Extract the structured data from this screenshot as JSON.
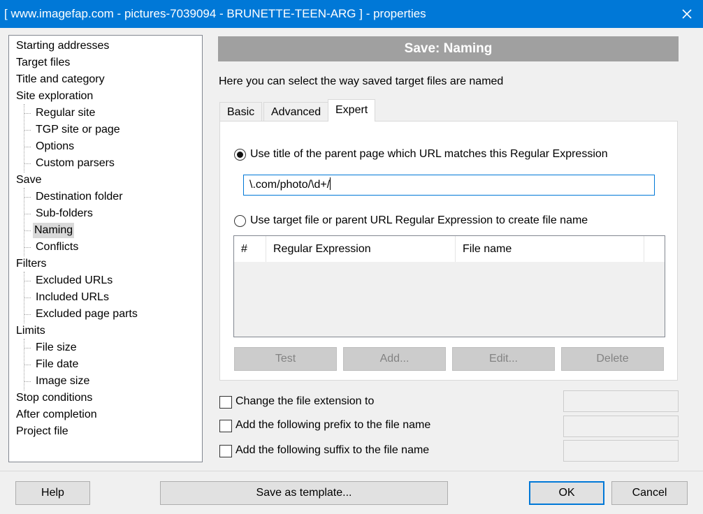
{
  "window": {
    "title": "[ www.imagefap.com - pictures-7039094 - BRUNETTE-TEEN-ARG ] - properties",
    "close_icon": "close-icon"
  },
  "tree": {
    "items": [
      {
        "label": "Starting addresses"
      },
      {
        "label": "Target files"
      },
      {
        "label": "Title and category"
      },
      {
        "label": "Site exploration"
      },
      {
        "label": "Regular site"
      },
      {
        "label": "TGP site or page"
      },
      {
        "label": "Options"
      },
      {
        "label": "Custom parsers"
      },
      {
        "label": "Save"
      },
      {
        "label": "Destination folder"
      },
      {
        "label": "Sub-folders"
      },
      {
        "label": "Naming",
        "selected": true
      },
      {
        "label": "Conflicts"
      },
      {
        "label": "Filters"
      },
      {
        "label": "Excluded URLs"
      },
      {
        "label": "Included URLs"
      },
      {
        "label": "Excluded page parts"
      },
      {
        "label": "Limits"
      },
      {
        "label": "File size"
      },
      {
        "label": "File date"
      },
      {
        "label": "Image size"
      },
      {
        "label": "Stop conditions"
      },
      {
        "label": "After completion"
      },
      {
        "label": "Project file"
      }
    ]
  },
  "panel": {
    "header": "Save: Naming",
    "description": "Here you can select the way saved target files are named",
    "tabs": [
      {
        "label": "Basic"
      },
      {
        "label": "Advanced"
      },
      {
        "label": "Expert",
        "active": true
      }
    ],
    "expert": {
      "radio_title": {
        "label": "Use title of the parent page which URL matches this Regular Expression",
        "checked": true
      },
      "regex_value": "\\.com/photo/\\d+/",
      "radio_target": {
        "label": "Use target file or parent URL Regular Expression to create file name",
        "checked": false
      },
      "grid_columns": [
        "#",
        "Regular Expression",
        "File name"
      ],
      "buttons": {
        "test": "Test",
        "add": "Add...",
        "edit": "Edit...",
        "delete": "Delete"
      }
    },
    "options": {
      "change_ext": {
        "label": "Change the file extension to",
        "checked": false
      },
      "prefix": {
        "label": "Add the following prefix to the file name",
        "checked": false
      },
      "suffix": {
        "label": "Add the following suffix to the file name",
        "checked": false
      }
    }
  },
  "footer": {
    "help": "Help",
    "save_template": "Save as template...",
    "ok": "OK",
    "cancel": "Cancel"
  }
}
